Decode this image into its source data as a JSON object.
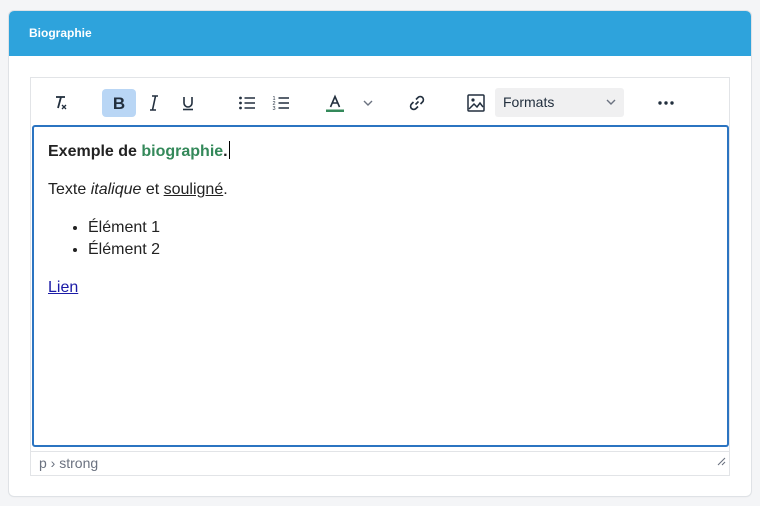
{
  "panel": {
    "title": "Biographie"
  },
  "toolbar": {
    "formats_label": "Formats"
  },
  "content": {
    "p1": {
      "bold_prefix": "Exemple de ",
      "green_word": "biographie",
      "suffix": "."
    },
    "p2": {
      "text_before": "Texte ",
      "italic": "italique",
      "text_mid": " et ",
      "underline": "souligné",
      "suffix": "."
    },
    "list": [
      "Élément 1",
      "Élément 2"
    ],
    "link_text": "Lien"
  },
  "statusbar": {
    "path": "p › strong"
  },
  "colors": {
    "header": "#2ea3dc",
    "accent_border": "#2b74c1",
    "green_text": "#34895a",
    "active_button": "#b9d6f5",
    "text_color_indicator": "#34895a"
  },
  "icons": [
    "clear-format-icon",
    "bold-icon",
    "italic-icon",
    "underline-icon",
    "bullet-list-icon",
    "numbered-list-icon",
    "text-color-icon",
    "chevron-down-icon",
    "link-icon",
    "image-icon",
    "more-icon",
    "resize-handle-icon"
  ]
}
